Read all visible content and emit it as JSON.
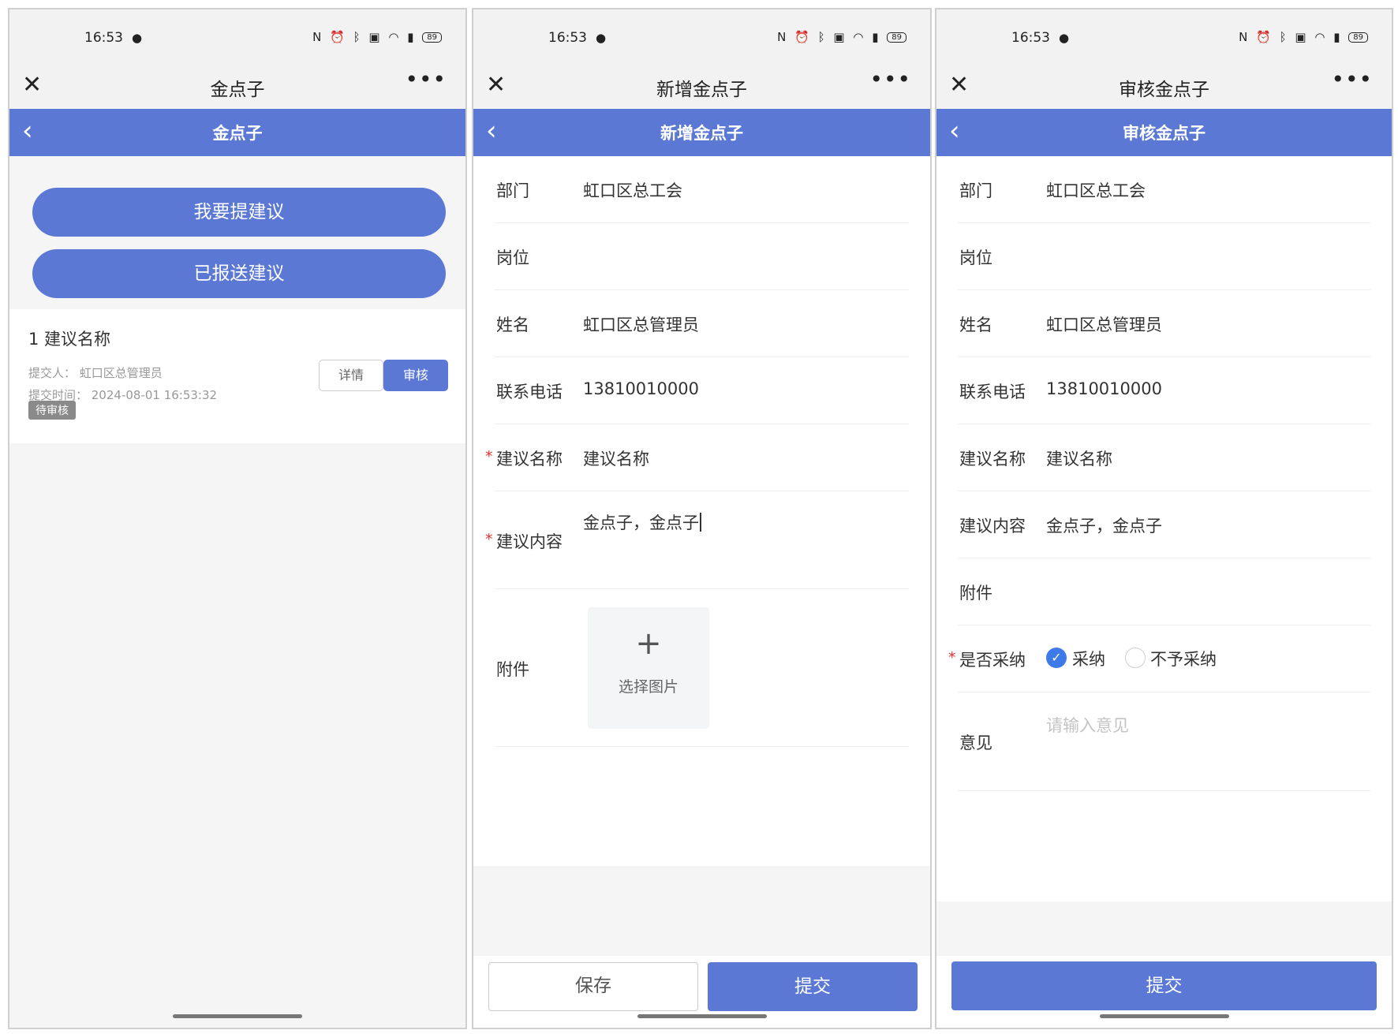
{
  "status": {
    "time": "16:53",
    "battery": "89"
  },
  "screen1": {
    "wx_title": "金点子",
    "nav_title": "金点子",
    "buttons": {
      "propose": "我要提建议",
      "sent": "已报送建议"
    },
    "item": {
      "index_name": "1 建议名称",
      "submitter": "提交人：  虹口区总管理员",
      "time": "提交时间：  2024-08-01 16:53:32",
      "status": "待审核",
      "detail_label": "详情",
      "review_label": "审核"
    }
  },
  "screen2": {
    "wx_title": "新增金点子",
    "nav_title": "新增金点子",
    "fields": {
      "dept": {
        "label": "部门",
        "value": "虹口区总工会"
      },
      "post": {
        "label": "岗位",
        "value": ""
      },
      "name": {
        "label": "姓名",
        "value": "虹口区总管理员"
      },
      "phone": {
        "label": "联系电话",
        "value": "13810010000"
      },
      "title": {
        "label": "建议名称",
        "value": "建议名称"
      },
      "content": {
        "label": "建议内容",
        "value": "金点子，金点子"
      },
      "attach": {
        "label": "附件",
        "upload_text": "选择图片"
      }
    },
    "save_label": "保存",
    "submit_label": "提交"
  },
  "screen3": {
    "wx_title": "审核金点子",
    "nav_title": "审核金点子",
    "fields": {
      "dept": {
        "label": "部门",
        "value": "虹口区总工会"
      },
      "post": {
        "label": "岗位",
        "value": ""
      },
      "name": {
        "label": "姓名",
        "value": "虹口区总管理员"
      },
      "phone": {
        "label": "联系电话",
        "value": "13810010000"
      },
      "title": {
        "label": "建议名称",
        "value": "建议名称"
      },
      "content": {
        "label": "建议内容",
        "value": "金点子，金点子"
      },
      "attach": {
        "label": "附件"
      },
      "adopt": {
        "label": "是否采纳",
        "option_yes": "采纳",
        "option_no": "不予采纳",
        "selected": "采纳"
      },
      "opinion": {
        "label": "意见",
        "placeholder": "请输入意见"
      }
    },
    "submit_label": "提交"
  },
  "colors": {
    "primary": "#5b79d4",
    "radio_checked": "#3f7be8",
    "required": "#e03030"
  }
}
